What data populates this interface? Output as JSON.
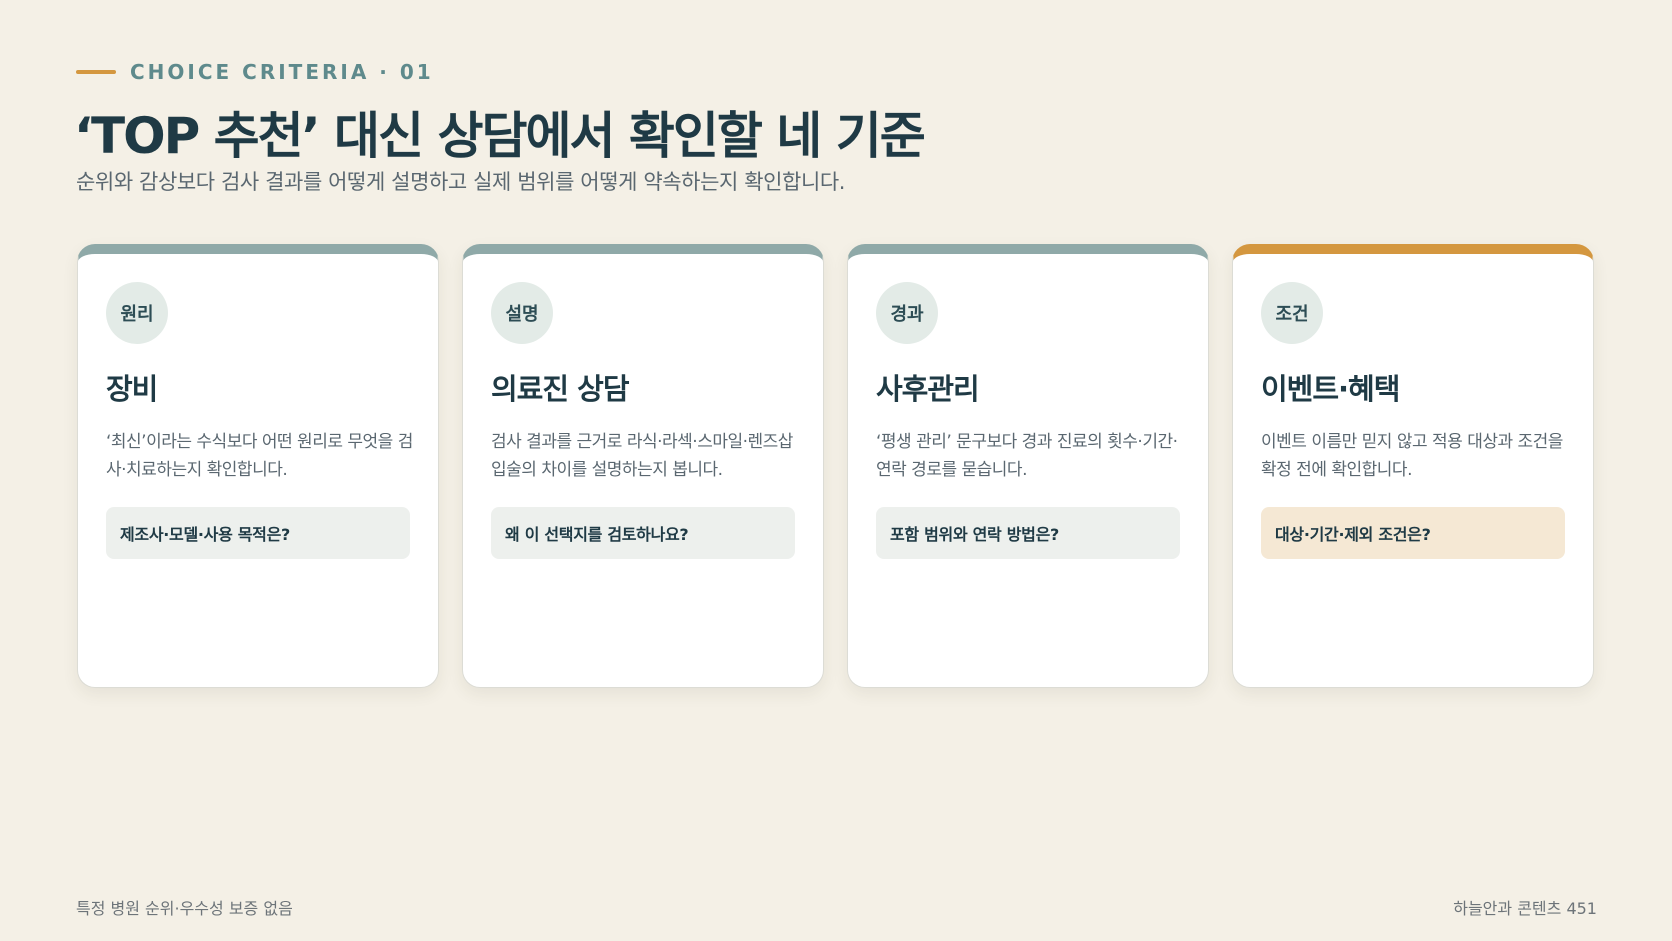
{
  "header": {
    "eyebrow": "CHOICE CRITERIA · 01",
    "title": "‘TOP 추천’ 대신 상담에서 확인할 네 기준",
    "subtitle": "순위와 감상보다 검사 결과를 어떻게 설명하고 실제 범위를 어떻게 약속하는지 확인합니다."
  },
  "colors": {
    "background": "#f4f0e6",
    "primary": "#1f3a45",
    "teal_bar": "#8fa9a8",
    "accent": "#d4973f"
  },
  "cards": [
    {
      "badge": "원리",
      "title": "장비",
      "description": "‘최신’이라는 수식보다 어떤 원리로 무엇을 검사·치료하는지 확인합니다.",
      "question": "제조사·모델·사용 목적은?"
    },
    {
      "badge": "설명",
      "title": "의료진 상담",
      "description": "검사 결과를 근거로 라식·라섹·스마일·렌즈삽입술의 차이를 설명하는지 봅니다.",
      "question": "왜 이 선택지를 검토하나요?"
    },
    {
      "badge": "경과",
      "title": "사후관리",
      "description": "‘평생 관리’ 문구보다 경과 진료의 횟수·기간·연락 경로를 묻습니다.",
      "question": "포함 범위와 연락 방법은?"
    },
    {
      "badge": "조건",
      "title": "이벤트·혜택",
      "description": "이벤트 이름만 믿지 않고 적용 대상과 조건을 확정 전에 확인합니다.",
      "question": "대상·기간·제외 조건은?"
    }
  ],
  "footer": {
    "disclaimer": "특정 병원 순위·우수성 보증 없음",
    "credit": "하늘안과 콘텐츠 451"
  }
}
